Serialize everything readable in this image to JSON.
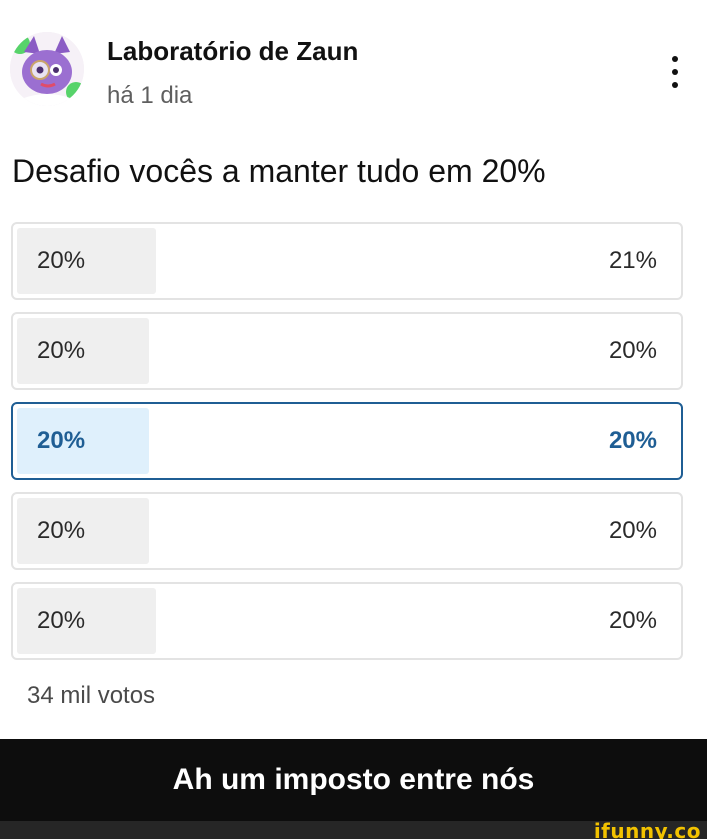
{
  "post": {
    "channel_name": "Laboratório de Zaun",
    "time_ago": "há 1 dia",
    "question": "Desafio vocês a manter tudo em 20%",
    "votes": "34 mil votos"
  },
  "poll": {
    "options": [
      {
        "label": "20%",
        "percent": "21%",
        "share": 0.21,
        "selected": false
      },
      {
        "label": "20%",
        "percent": "20%",
        "share": 0.2,
        "selected": false
      },
      {
        "label": "20%",
        "percent": "20%",
        "share": 0.2,
        "selected": true
      },
      {
        "label": "20%",
        "percent": "20%",
        "share": 0.2,
        "selected": false
      },
      {
        "label": "20%",
        "percent": "20%",
        "share": 0.21,
        "selected": false
      }
    ]
  },
  "caption": "Ah um imposto entre nós",
  "watermark": "ifunny.co",
  "colors": {
    "accent": "#1f5e94",
    "selected_fill": "#dff0fc",
    "bar_fill": "#efefef",
    "caption_bg": "#0d0d0d",
    "watermark": "#f2c200"
  },
  "icons": {
    "more": "more-vertical-icon",
    "avatar": "avatar-cartoon-cat-icon"
  }
}
